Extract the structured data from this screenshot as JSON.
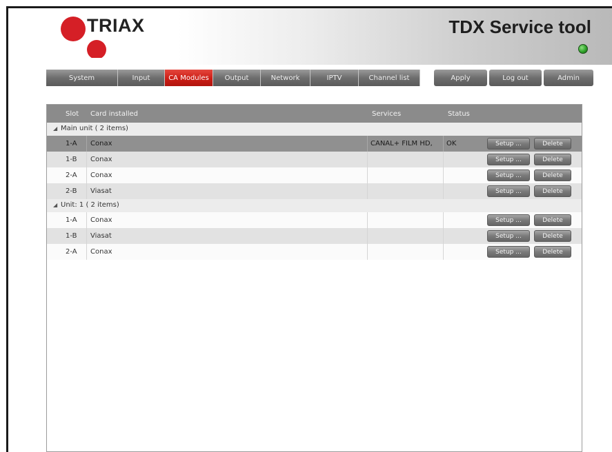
{
  "header": {
    "brand": "TRIAX",
    "app_title": "TDX Service tool",
    "status_color": "#2fa32a",
    "brand_color": "#d51f26"
  },
  "nav": {
    "tabs": [
      {
        "label": "System",
        "active": false
      },
      {
        "label": "Input",
        "active": false
      },
      {
        "label": "CA Modules",
        "active": true
      },
      {
        "label": "Output",
        "active": false
      },
      {
        "label": "Network",
        "active": false
      },
      {
        "label": "IPTV",
        "active": false
      },
      {
        "label": "Channel list",
        "active": false
      }
    ],
    "apply_label": "Apply",
    "logout_label": "Log out",
    "admin_label": "Admin"
  },
  "table": {
    "headers": {
      "slot": "Slot",
      "card": "Card installed",
      "services": "Services",
      "status": "Status"
    },
    "setup_label": "Setup ...",
    "delete_label": "Delete",
    "groups": [
      {
        "label": "Main unit ( 2 items)",
        "rows": [
          {
            "slot": "1-A",
            "card": "Conax",
            "services": "CANAL+ FILM HD,",
            "status": "OK",
            "selected": true
          },
          {
            "slot": "1-B",
            "card": "Conax",
            "services": "",
            "status": "",
            "selected": false
          },
          {
            "slot": "2-A",
            "card": "Conax",
            "services": "",
            "status": "",
            "selected": false
          },
          {
            "slot": "2-B",
            "card": "Viasat",
            "services": "",
            "status": "",
            "selected": false
          }
        ]
      },
      {
        "label": "Unit: 1 ( 2 items)",
        "rows": [
          {
            "slot": "1-A",
            "card": "Conax",
            "services": "",
            "status": "",
            "selected": false
          },
          {
            "slot": "1-B",
            "card": "Viasat",
            "services": "",
            "status": "",
            "selected": false
          },
          {
            "slot": "2-A",
            "card": "Conax",
            "services": "",
            "status": "",
            "selected": false
          }
        ]
      }
    ]
  }
}
